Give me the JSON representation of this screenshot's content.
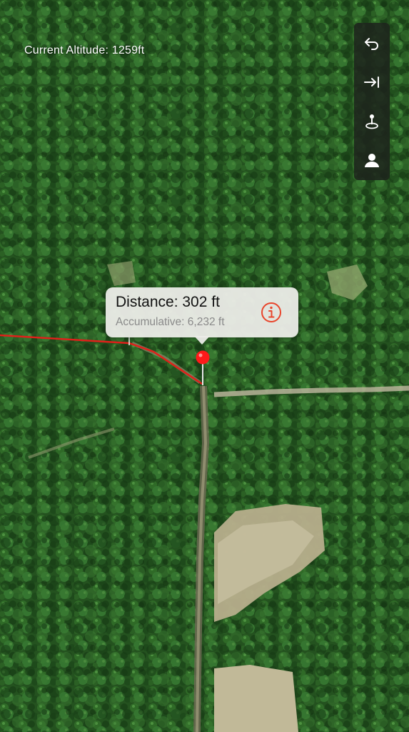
{
  "map": {
    "altitude_text": "Current Altitude: 1259ft",
    "route_color": "#e0201a",
    "pin_color": "#ff1a1a"
  },
  "toolbar": {
    "buttons": [
      {
        "icon": "undo-icon"
      },
      {
        "icon": "arrow-to-line-icon"
      },
      {
        "icon": "pin-location-icon"
      },
      {
        "icon": "user-icon"
      }
    ]
  },
  "callout": {
    "title": "Distance: 302 ft",
    "subtitle": "Accumulative: 6,232 ft",
    "info_icon": "info-icon",
    "accent_color": "#e8452c"
  }
}
